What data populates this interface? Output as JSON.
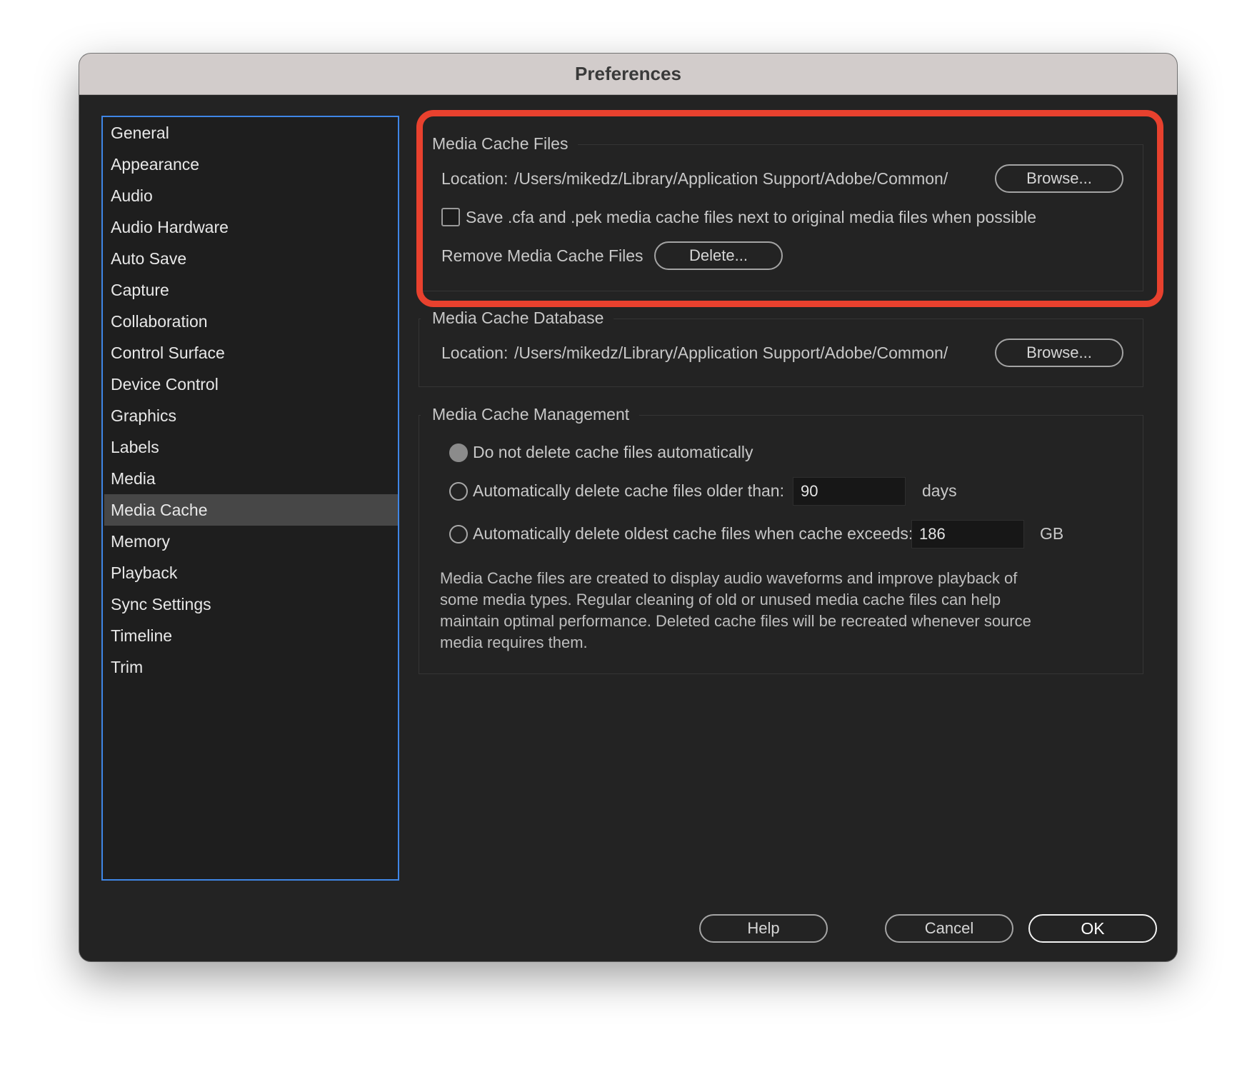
{
  "window": {
    "title": "Preferences"
  },
  "sidebar": {
    "items": [
      {
        "label": "General"
      },
      {
        "label": "Appearance"
      },
      {
        "label": "Audio"
      },
      {
        "label": "Audio Hardware"
      },
      {
        "label": "Auto Save"
      },
      {
        "label": "Capture"
      },
      {
        "label": "Collaboration"
      },
      {
        "label": "Control Surface"
      },
      {
        "label": "Device Control"
      },
      {
        "label": "Graphics"
      },
      {
        "label": "Labels"
      },
      {
        "label": "Media"
      },
      {
        "label": "Media Cache",
        "selected": true
      },
      {
        "label": "Memory"
      },
      {
        "label": "Playback"
      },
      {
        "label": "Sync Settings"
      },
      {
        "label": "Timeline"
      },
      {
        "label": "Trim"
      }
    ]
  },
  "media_cache_files": {
    "heading": "Media Cache Files",
    "location_label": "Location:",
    "location_path": "/Users/mikedz/Library/Application Support/Adobe/Common/",
    "browse_label": "Browse...",
    "save_next_checkbox": {
      "label": "Save .cfa and .pek media cache files next to original media files when possible",
      "checked": false
    },
    "remove_label": "Remove Media Cache Files",
    "delete_label": "Delete..."
  },
  "media_cache_database": {
    "heading": "Media Cache Database",
    "location_label": "Location:",
    "location_path": "/Users/mikedz/Library/Application Support/Adobe/Common/",
    "browse_label": "Browse..."
  },
  "media_cache_management": {
    "heading": "Media Cache Management",
    "options": [
      {
        "label": "Do not delete cache files automatically",
        "selected": true
      },
      {
        "label": "Automatically delete cache files older than:",
        "value": "90",
        "unit": "days",
        "selected": false
      },
      {
        "label": "Automatically delete oldest cache files when cache exceeds:",
        "value": "186",
        "unit": "GB",
        "selected": false
      }
    ],
    "description": "Media Cache files are created to display audio waveforms and improve playback of some media types.  Regular cleaning of old or unused media cache files can help maintain optimal performance. Deleted cache files will be recreated whenever source media requires them."
  },
  "footer": {
    "help_label": "Help",
    "cancel_label": "Cancel",
    "ok_label": "OK"
  },
  "colors": {
    "window_bg": "#232323",
    "titlebar_bg": "#d2cccb",
    "sidebar_border": "#3f86e6",
    "selected_item_bg": "#474747",
    "highlight_annotation": "#e8412e"
  }
}
